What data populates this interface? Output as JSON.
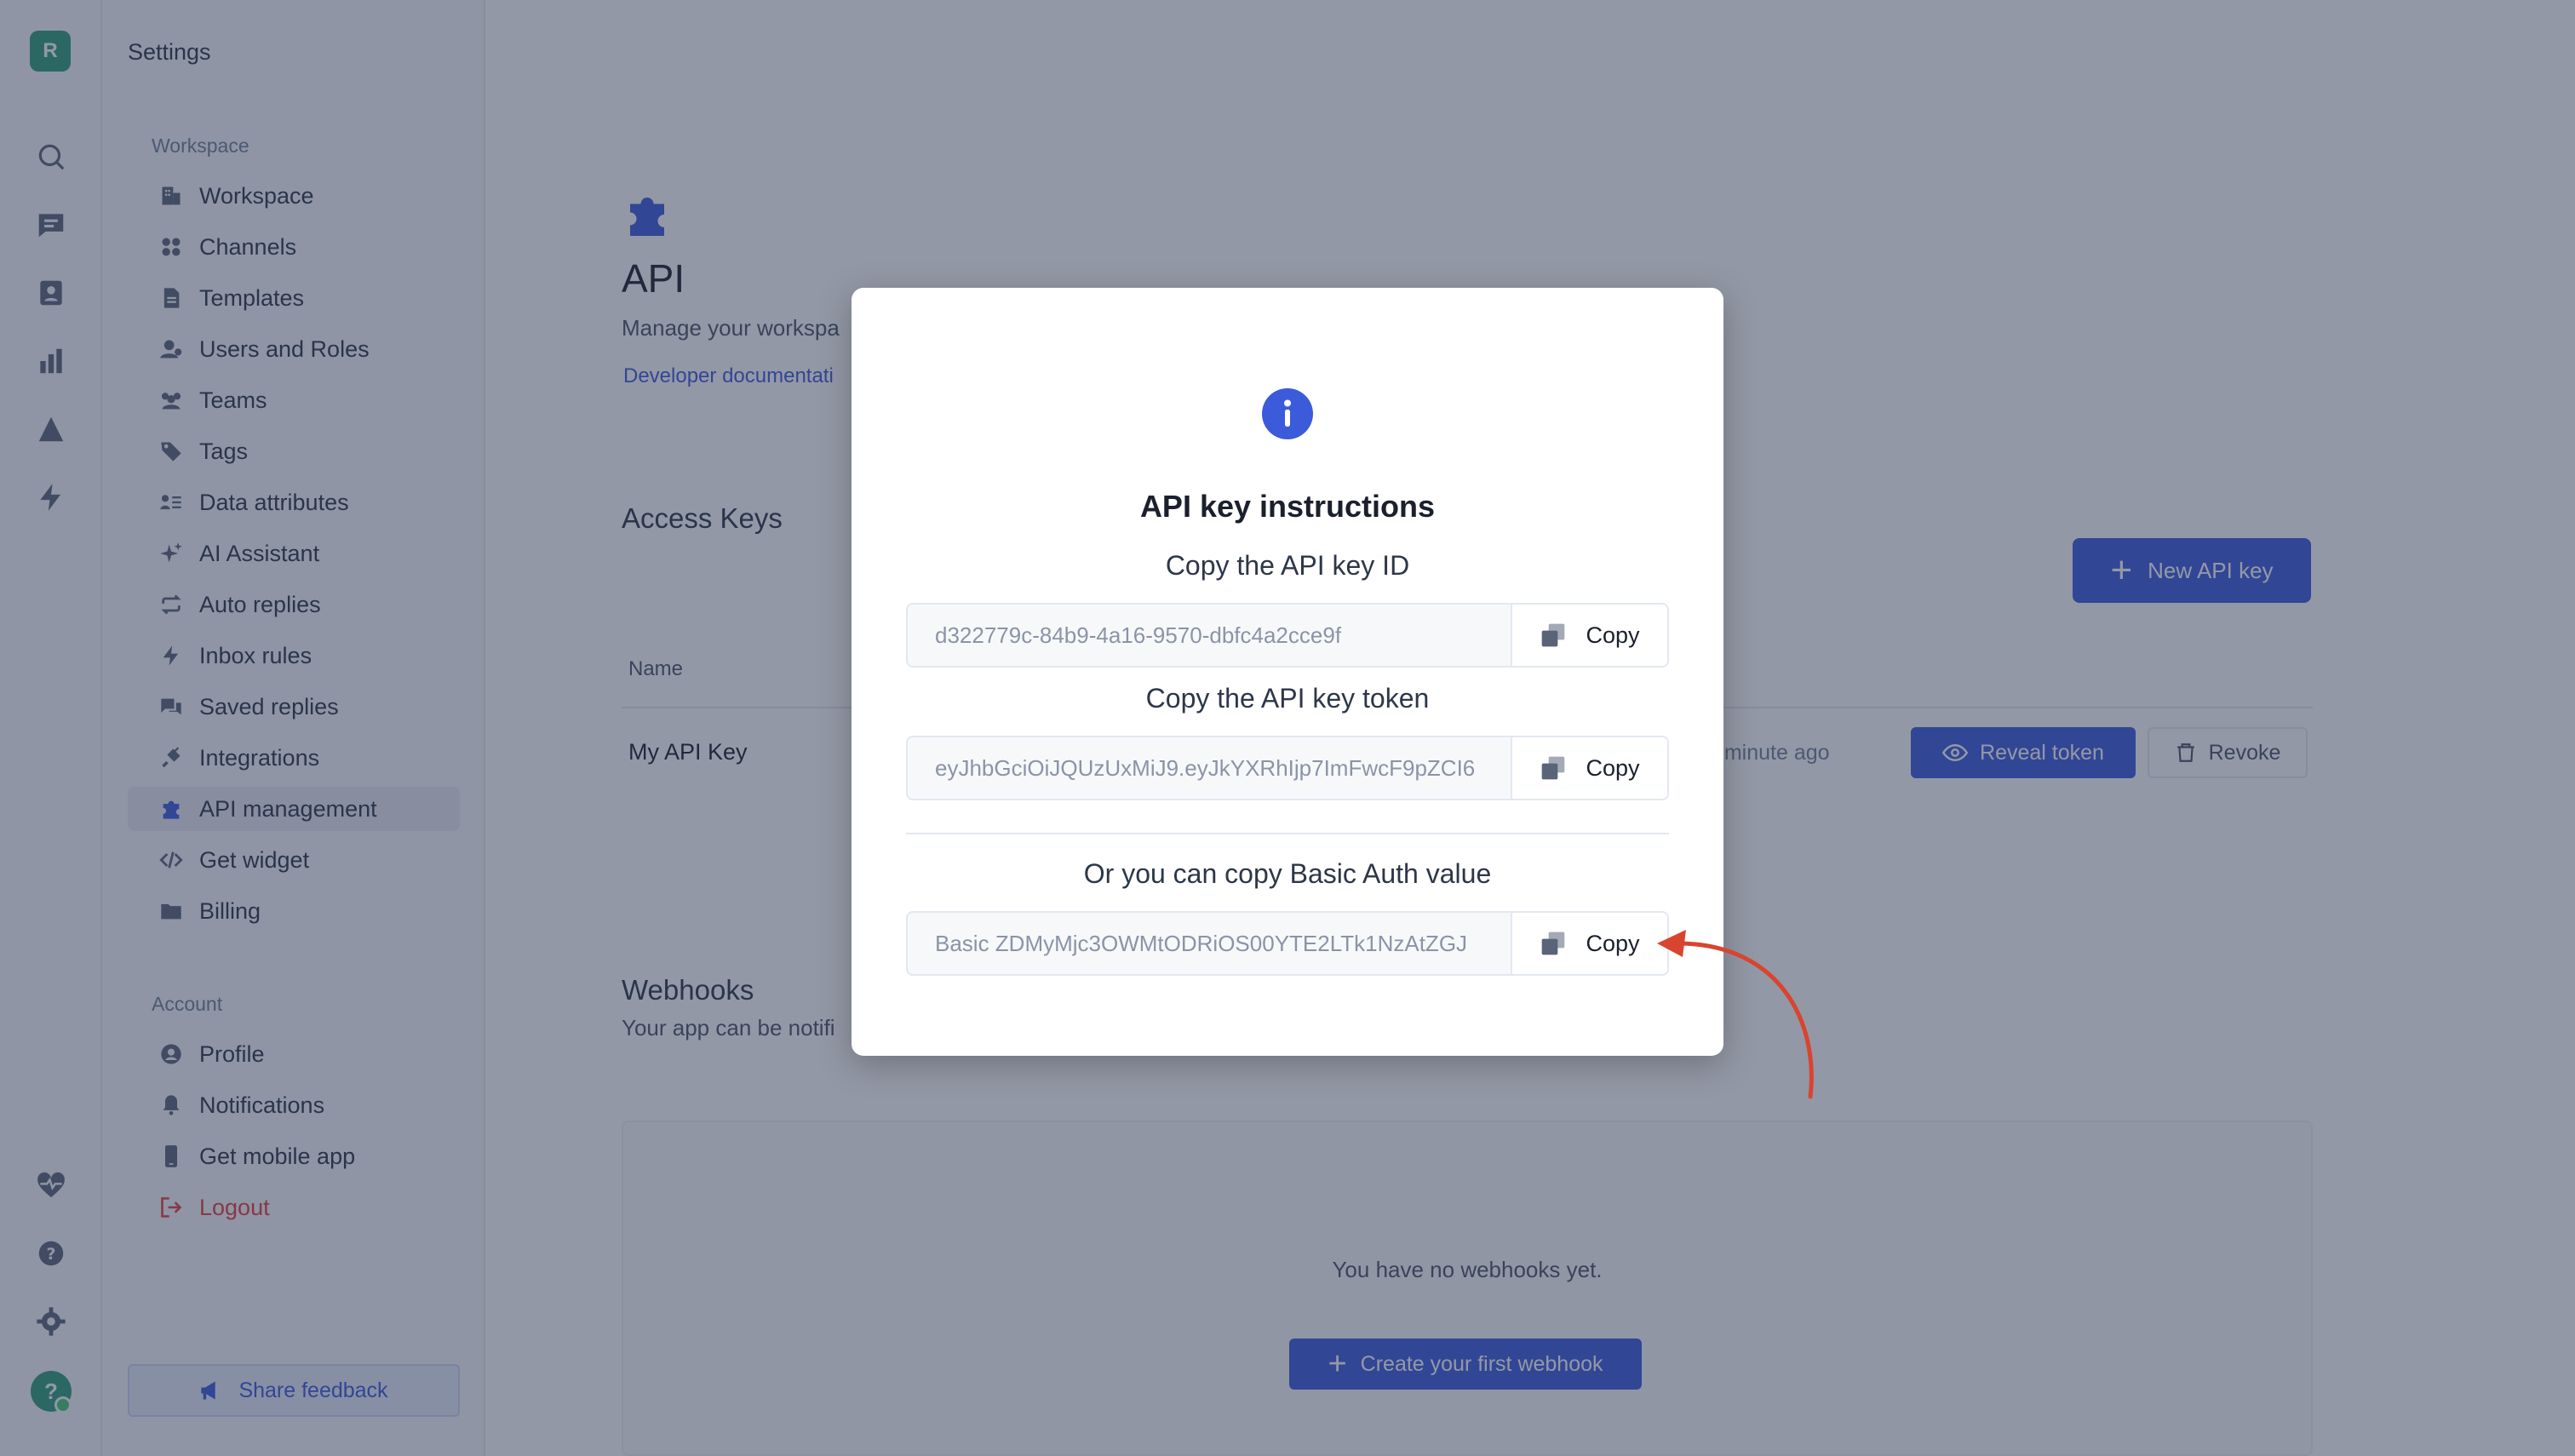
{
  "workspace": {
    "initial": "R"
  },
  "user": {
    "initial": "?"
  },
  "sidebar": {
    "title": "Settings",
    "workspace_section": "Workspace",
    "items": [
      {
        "label": "Workspace",
        "icon": "building-icon"
      },
      {
        "label": "Channels",
        "icon": "grid-icon"
      },
      {
        "label": "Templates",
        "icon": "document-icon"
      },
      {
        "label": "Users and Roles",
        "icon": "user-gear-icon"
      },
      {
        "label": "Teams",
        "icon": "people-icon"
      },
      {
        "label": "Tags",
        "icon": "tag-icon"
      },
      {
        "label": "Data attributes",
        "icon": "list-icon"
      },
      {
        "label": "AI Assistant",
        "icon": "sparkle-icon"
      },
      {
        "label": "Auto replies",
        "icon": "repeat-icon"
      },
      {
        "label": "Inbox rules",
        "icon": "bolt-icon"
      },
      {
        "label": "Saved replies",
        "icon": "chat-icon"
      },
      {
        "label": "Integrations",
        "icon": "plug-icon"
      },
      {
        "label": "API management",
        "icon": "puzzle-icon"
      },
      {
        "label": "Get widget",
        "icon": "code-icon"
      },
      {
        "label": "Billing",
        "icon": "folder-icon"
      }
    ],
    "account_section": "Account",
    "account_items": [
      {
        "label": "Profile",
        "icon": "user-circle-icon"
      },
      {
        "label": "Notifications",
        "icon": "bell-icon"
      },
      {
        "label": "Get mobile app",
        "icon": "phone-icon"
      },
      {
        "label": "Logout",
        "icon": "logout-icon"
      }
    ],
    "feedback": "Share feedback"
  },
  "main": {
    "title": "API",
    "subtitle": "Manage your workspa",
    "doc_link": "Developer documentati",
    "access_keys": {
      "title": "Access Keys",
      "new_key": "New API key",
      "column_name": "Name",
      "row": {
        "name": "My API Key",
        "time": "a minute ago",
        "reveal": "Reveal token",
        "revoke": "Revoke"
      }
    },
    "webhooks": {
      "title": "Webhooks",
      "subtitle": "Your app can be notifi",
      "empty": "You have no webhooks yet.",
      "create": "Create your first webhook"
    }
  },
  "modal": {
    "title": "API key instructions",
    "key_id_label": "Copy the API key ID",
    "key_id_value": "d322779c-84b9-4a16-9570-dbfc4a2cce9f",
    "token_label": "Copy the API key token",
    "token_value": "eyJhbGciOiJQUzUxMiJ9.eyJkYXRhIjp7ImFwcF9pZCI6",
    "basic_label": "Or you can copy Basic Auth value",
    "basic_value": "Basic ZDMyMjc3OWMtODRiOS00YTE2LTk1NzAtZGJ",
    "copy": "Copy"
  },
  "colors": {
    "accent": "#3b5bdb",
    "danger": "#e53e3e",
    "brand": "#2f9e7a",
    "annotation": "#d9442f"
  }
}
